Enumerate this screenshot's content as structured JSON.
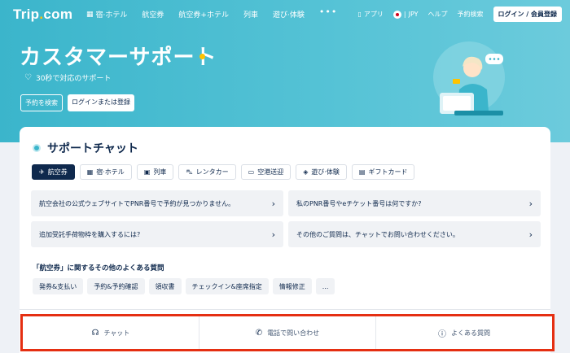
{
  "nav": {
    "logo_main": "Trip",
    "logo_dot": ".",
    "logo_suffix": "com",
    "items": [
      {
        "label": "宿·ホテル",
        "icon": "hotel-icon"
      },
      {
        "label": "航空券",
        "icon": ""
      },
      {
        "label": "航空券+ホテル",
        "icon": ""
      },
      {
        "label": "列車",
        "icon": ""
      },
      {
        "label": "遊び·体験",
        "icon": ""
      }
    ],
    "more": "•••",
    "right": {
      "app": "アプリ",
      "currency": "JPY",
      "help": "ヘルプ",
      "bookings": "予約検索",
      "login": "ログイン / 会員登録"
    }
  },
  "hero": {
    "title": "カスタマーサポート",
    "subtitle": "30秒で対応のサポート",
    "buttons": {
      "search_booking": "予約を検索",
      "login_or_register": "ログインまたは登録"
    }
  },
  "chat": {
    "title": "サポートチャット",
    "tabs": [
      {
        "label": "航空券",
        "icon": "plane-icon",
        "active": true
      },
      {
        "label": "宿·ホテル",
        "icon": "hotel-icon",
        "active": false
      },
      {
        "label": "列車",
        "icon": "train-icon",
        "active": false
      },
      {
        "label": "レンタカー",
        "icon": "car-icon",
        "active": false
      },
      {
        "label": "空港送迎",
        "icon": "shuttle-icon",
        "active": false
      },
      {
        "label": "遊び·体験",
        "icon": "ticket-icon",
        "active": false
      },
      {
        "label": "ギフトカード",
        "icon": "giftcard-icon",
        "active": false
      }
    ],
    "questions": [
      "航空会社の公式ウェブサイトでPNR番号で予約が見つかりません。",
      "私のPNR番号やeチケット番号は何ですか?",
      "追加受託手荷物枠を購入するには?",
      "その他のご質問は、チャットでお問い合わせください。"
    ],
    "faq_heading": "「航空券」に関するその他のよくある質問",
    "faq_chips": [
      "発券&支払い",
      "予約&予約確認",
      "領収書",
      "チェックイン&座席指定",
      "情報修正",
      "..."
    ]
  },
  "bottom_bar": {
    "items": [
      {
        "label": "チャット",
        "icon": "headset-icon"
      },
      {
        "label": "電話で問い合わせ",
        "icon": "phone-icon"
      },
      {
        "label": "よくある質問",
        "icon": "info-icon"
      }
    ]
  },
  "colors": {
    "brand_teal": "#3bb5cb",
    "navy": "#0f294d",
    "accent_yellow": "#ffc300",
    "highlight_red": "#e52f12"
  }
}
